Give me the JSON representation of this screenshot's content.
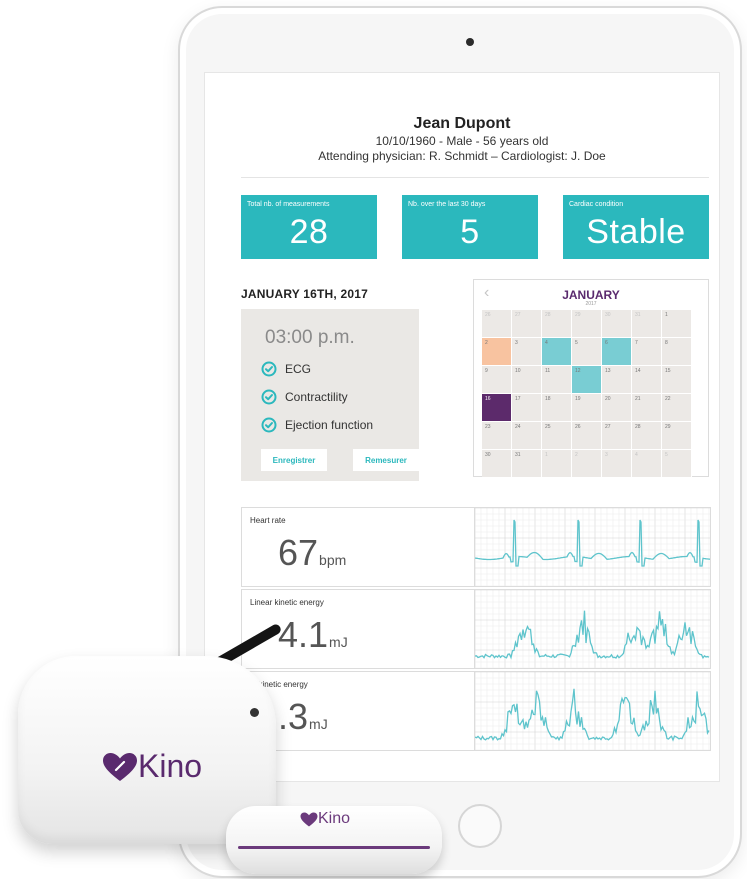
{
  "patient": {
    "name": "Jean Dupont",
    "details": "10/10/1960 - Male - 56 years old",
    "physicians": "Attending physician: R. Schmidt – Cardiologist: J. Doe"
  },
  "stats": [
    {
      "label": "Total nb. of measurements",
      "value": "28"
    },
    {
      "label": "Nb. over the last 30 days",
      "value": "5"
    },
    {
      "label": "Cardiac condition",
      "value": "Stable"
    }
  ],
  "session": {
    "date": "JANUARY 16TH, 2017",
    "time": "03:00 p.m.",
    "checks": [
      "ECG",
      "Contractility",
      "Ejection function"
    ],
    "record_button": "Enregistrer",
    "remeasure_button": "Remesurer"
  },
  "calendar": {
    "prev_icon": "chevron-left-icon",
    "month": "JANUARY",
    "year": "2017",
    "weeks": [
      [
        [
          "26",
          "other"
        ],
        [
          "27",
          "other"
        ],
        [
          "28",
          "other"
        ],
        [
          "29",
          "other"
        ],
        [
          "30",
          "other"
        ],
        [
          "31",
          "other"
        ],
        [
          "1",
          ""
        ]
      ],
      [
        [
          "2",
          "orange"
        ],
        [
          "3",
          ""
        ],
        [
          "4",
          "teal"
        ],
        [
          "5",
          ""
        ],
        [
          "6",
          "teal"
        ],
        [
          "7",
          ""
        ],
        [
          "8",
          ""
        ]
      ],
      [
        [
          "9",
          ""
        ],
        [
          "10",
          ""
        ],
        [
          "11",
          ""
        ],
        [
          "12",
          "teal"
        ],
        [
          "13",
          ""
        ],
        [
          "14",
          ""
        ],
        [
          "15",
          ""
        ]
      ],
      [
        [
          "16",
          "purple"
        ],
        [
          "17",
          ""
        ],
        [
          "18",
          ""
        ],
        [
          "19",
          ""
        ],
        [
          "20",
          ""
        ],
        [
          "21",
          ""
        ],
        [
          "22",
          ""
        ]
      ],
      [
        [
          "23",
          ""
        ],
        [
          "24",
          ""
        ],
        [
          "25",
          ""
        ],
        [
          "26",
          ""
        ],
        [
          "27",
          ""
        ],
        [
          "28",
          ""
        ],
        [
          "29",
          ""
        ]
      ],
      [
        [
          "30",
          ""
        ],
        [
          "31",
          ""
        ],
        [
          "1",
          "other"
        ],
        [
          "2",
          "other"
        ],
        [
          "3",
          "other"
        ],
        [
          "4",
          "other"
        ],
        [
          "5",
          "other"
        ]
      ]
    ]
  },
  "metrics": [
    {
      "label": "Heart rate",
      "value": "67",
      "unit": "bpm"
    },
    {
      "label": "Linear kinetic energy",
      "value": "4.1",
      "unit": "mJ"
    },
    {
      "label": "al kinetic energy",
      "value": ".3",
      "unit": "mJ"
    }
  ],
  "device": {
    "brand": "Kino",
    "logo_icon": "heart-icon"
  },
  "colors": {
    "teal": "#2bb8bd",
    "purple": "#5c2a6b",
    "orange": "#f8c3a0",
    "light_teal": "#79cdd3"
  }
}
